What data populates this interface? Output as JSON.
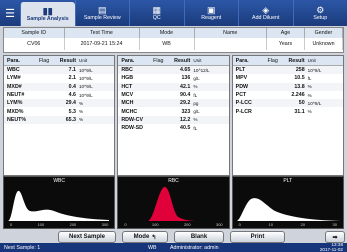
{
  "tabs": [
    {
      "label": "Sample Analysis",
      "icon": "bar-chart-icon",
      "glyph": "▮▮"
    },
    {
      "label": "Sample Review",
      "icon": "document-icon",
      "glyph": "▤"
    },
    {
      "label": "QC",
      "icon": "grid-icon",
      "glyph": "▦"
    },
    {
      "label": "Reagent",
      "icon": "bottle-icon",
      "glyph": "▣"
    },
    {
      "label": "Add Diluent",
      "icon": "drop-icon",
      "glyph": "◈"
    },
    {
      "label": "Setup",
      "icon": "gear-icon",
      "glyph": "⚙"
    }
  ],
  "menu_glyph": "☰",
  "sample": {
    "headers": [
      "Sample ID",
      "Test Time",
      "Mode",
      "Name",
      "Age",
      "Gender"
    ],
    "values": [
      "CV06",
      "2017-09-21  15:24",
      "WB",
      "",
      "Years",
      "Unknown"
    ]
  },
  "result_headers": [
    "Para.",
    "Flag",
    "Result",
    "Unit"
  ],
  "wbc_panel": [
    [
      "WBC",
      "",
      "7.1",
      "10^9/L"
    ],
    [
      "LYM#",
      "",
      "2.1",
      "10^9/L"
    ],
    [
      "MXD#",
      "",
      "0.4",
      "10^9/L"
    ],
    [
      "NEUT#",
      "",
      "4.6",
      "10^9/L"
    ],
    [
      "LYM%",
      "",
      "29.4",
      "%"
    ],
    [
      "MXD%",
      "",
      "5.3",
      "%"
    ],
    [
      "NEUT%",
      "",
      "65.3",
      "%"
    ]
  ],
  "rbc_panel": [
    [
      "RBC",
      "",
      "4.65",
      "10^12/L"
    ],
    [
      "HGB",
      "",
      "136",
      "g/L"
    ],
    [
      "HCT",
      "",
      "42.1",
      "%"
    ],
    [
      "MCV",
      "",
      "90.4",
      "fL"
    ],
    [
      "MCH",
      "",
      "29.2",
      "pg"
    ],
    [
      "MCHC",
      "",
      "323",
      "g/L"
    ],
    [
      "RDW-CV",
      "",
      "12.2",
      "%"
    ],
    [
      "RDW-SD",
      "",
      "40.5",
      "fL"
    ]
  ],
  "plt_panel": [
    [
      "PLT",
      "",
      "258",
      "10^9/L"
    ],
    [
      "MPV",
      "",
      "10.5",
      "fL"
    ],
    [
      "PDW",
      "",
      "13.8",
      "%"
    ],
    [
      "PCT",
      "",
      "2.246",
      "%"
    ],
    [
      "P-LCC",
      "",
      "50",
      "10^9/L"
    ],
    [
      "P-LCR",
      "",
      "31.1",
      "%"
    ]
  ],
  "hist": {
    "wbc": {
      "title": "WBC",
      "ticks": [
        "0",
        "100",
        "200",
        "300"
      ],
      "color": "#ffffff"
    },
    "rbc": {
      "title": "RBC",
      "ticks": [
        "0",
        "100",
        "200",
        "300"
      ],
      "color": "#e0003a"
    },
    "plt": {
      "title": "PLT",
      "ticks": [
        "0",
        "10",
        "20",
        "30"
      ],
      "color": "#ffffff"
    }
  },
  "buttons": {
    "next_sample": "Next Sample",
    "mode": "Mode",
    "mode_glyph": "↰",
    "blank": "Blank",
    "print": "Print",
    "next_arrow": "➡"
  },
  "status": {
    "next_sample": "Next Sample: 1",
    "mode": "WB",
    "user": "Administrator: admin",
    "time": "13:38",
    "date": "2017-11-02"
  }
}
